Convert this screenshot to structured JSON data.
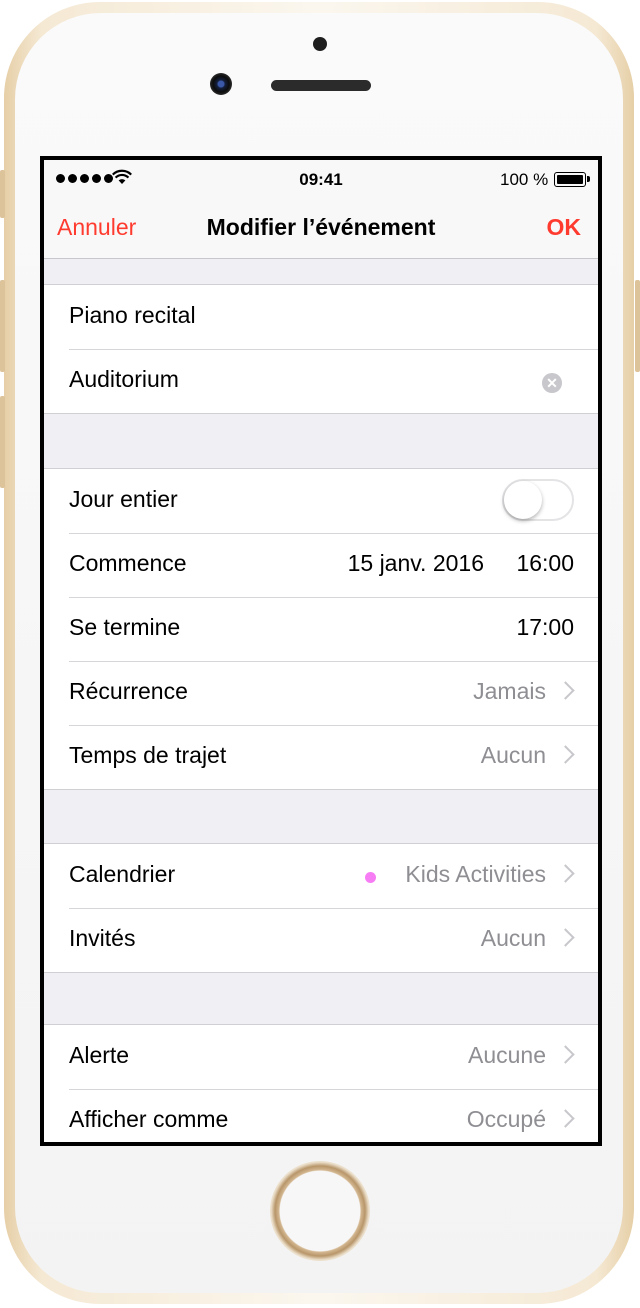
{
  "status_bar": {
    "time": "09:41",
    "battery": "100 %"
  },
  "nav": {
    "cancel_label": "Annuler",
    "title": "Modifier l’événement",
    "ok_label": "OK"
  },
  "event": {
    "title": "Piano recital",
    "location": "Auditorium"
  },
  "details": {
    "all_day": {
      "label": "Jour entier",
      "on": false
    },
    "starts": {
      "label": "Commence",
      "date": "15 janv. 2016",
      "time": "16:00"
    },
    "ends": {
      "label": "Se termine",
      "time": "17:00"
    },
    "repeat": {
      "label": "Récurrence",
      "value": "Jamais"
    },
    "travel": {
      "label": "Temps de trajet",
      "value": "Aucun"
    }
  },
  "calendar": {
    "calendar": {
      "label": "Calendrier",
      "value": "Kids Activities",
      "dot_color": "#f77df5"
    },
    "invitees": {
      "label": "Invités",
      "value": "Aucun"
    }
  },
  "alerts": {
    "alert": {
      "label": "Alerte",
      "value": "Aucune"
    },
    "show_as": {
      "label": "Afficher comme",
      "value": "Occupé"
    }
  },
  "colors": {
    "accent": "#ff3b30",
    "secondary_text": "#8e8e93"
  }
}
